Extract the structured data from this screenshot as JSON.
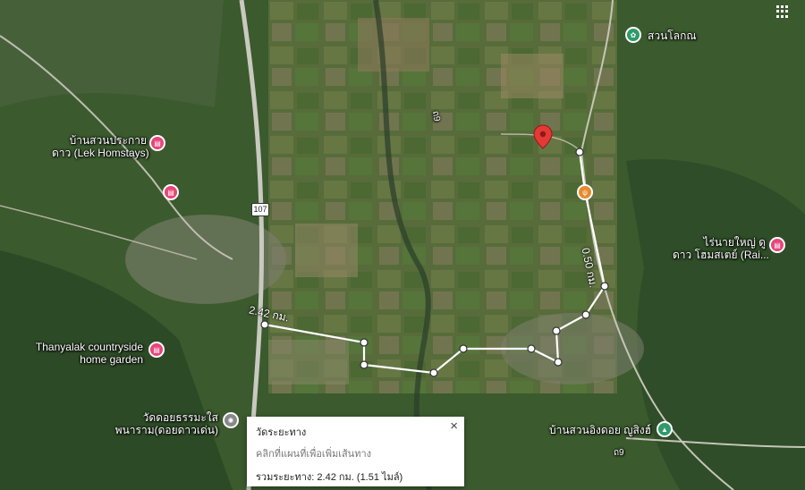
{
  "places": {
    "suan_lok": "สวนโลกณ",
    "ban_suan_line1": "บ้านสวนประกาย",
    "ban_suan_line2": "ดาว (Lek Homstays)",
    "rai_line1": "ไร่นายใหญ่ ดู",
    "rai_line2": "ดาว โฮมสเตย์ (Rai...",
    "thanyalak_line1": "Thanyalak countryside",
    "thanyalak_line2": "home garden",
    "wat_line1": "วัดดอยธรรมะใส",
    "wat_line2": "พนาราม(ดอยดาวเด่น)",
    "ban_suan_ing_doi": "บ้านสวนอิงดอย ญูสิงฮ์"
  },
  "road_number": "107",
  "road_label_small": "ถ9",
  "road_label_small2": "ถ9",
  "distance_labels": {
    "left": "2.42 กม.",
    "right": "0.50 กม."
  },
  "popup": {
    "title": "วัดระยะทาง",
    "hint": "คลิกที่แผนที่เพื่อเพิ่มเส้นทาง",
    "total": "รวมระยะทาง: 2.42 กม. (1.51 ไมล์)",
    "close": "×"
  },
  "colors": {
    "marker_red": "#e53935",
    "poi_pink": "#e8457a",
    "poi_teal": "#2e9b6a",
    "poi_orange": "#e8892c"
  }
}
